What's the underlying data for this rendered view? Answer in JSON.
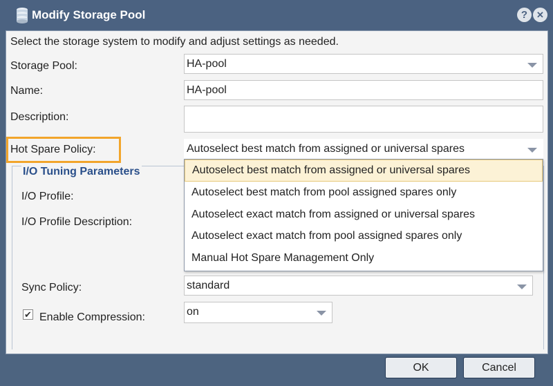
{
  "window": {
    "title": "Modify Storage Pool",
    "help_label": "?",
    "close_label": "✕"
  },
  "form": {
    "intro": "Select the storage system to modify and adjust settings as needed.",
    "storage_pool_label": "Storage Pool:",
    "storage_pool_value": "HA-pool",
    "name_label": "Name:",
    "name_value": "HA-pool",
    "description_label": "Description:",
    "description_value": "",
    "hot_spare_label": "Hot Spare Policy:",
    "hot_spare_value": "Autoselect best match from assigned or universal spares",
    "io_section_title": "I/O Tuning Parameters",
    "io_profile_label": "I/O Profile:",
    "io_profile_desc_label": "I/O Profile Description:",
    "sync_policy_label": "Sync Policy:",
    "sync_policy_value": "standard",
    "compression_label": "Enable Compression:",
    "compression_checked": true,
    "compression_value": "on"
  },
  "hot_spare_options": [
    "Autoselect best match from assigned or universal spares",
    "Autoselect best match from pool assigned spares only",
    "Autoselect exact match from assigned or universal spares",
    "Autoselect exact match from pool assigned spares only",
    "Manual Hot Spare Management Only"
  ],
  "buttons": {
    "ok": "OK",
    "cancel": "Cancel"
  },
  "colors": {
    "titlebar": "#4b6281",
    "highlight": "#f2a52b",
    "section_title": "#2a4f8a",
    "selected_option": "#fcf2d6"
  }
}
